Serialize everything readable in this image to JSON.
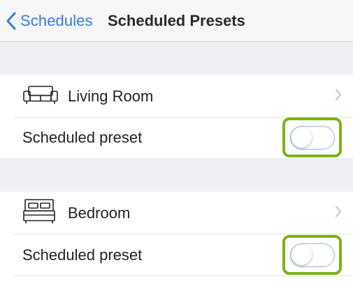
{
  "nav": {
    "back_label": "Schedules",
    "title": "Scheduled Presets"
  },
  "rooms": [
    {
      "name": "Living Room",
      "icon": "sofa-icon",
      "preset_label": "Scheduled preset",
      "preset_on": false
    },
    {
      "name": "Bedroom",
      "icon": "bed-icon",
      "preset_label": "Scheduled preset",
      "preset_on": false
    }
  ],
  "colors": {
    "accent": "#3a7bd5",
    "highlight": "#7ab317",
    "toggle_border": "#8fb6e8",
    "group_background": "#efeff4"
  }
}
